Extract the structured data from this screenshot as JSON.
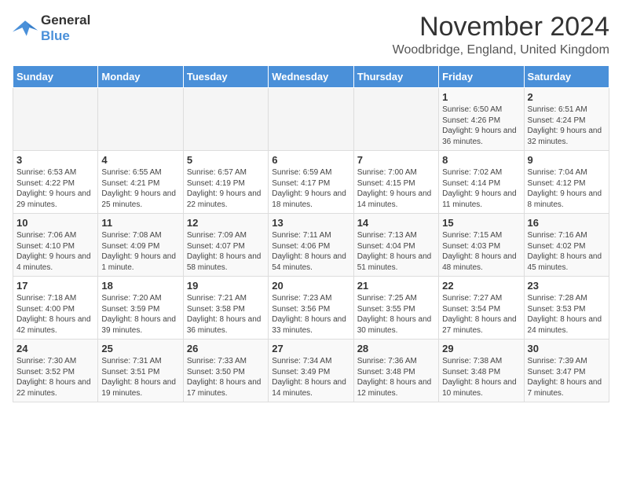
{
  "header": {
    "logo_line1": "General",
    "logo_line2": "Blue",
    "month": "November 2024",
    "location": "Woodbridge, England, United Kingdom"
  },
  "days_of_week": [
    "Sunday",
    "Monday",
    "Tuesday",
    "Wednesday",
    "Thursday",
    "Friday",
    "Saturday"
  ],
  "weeks": [
    [
      {
        "day": "",
        "info": ""
      },
      {
        "day": "",
        "info": ""
      },
      {
        "day": "",
        "info": ""
      },
      {
        "day": "",
        "info": ""
      },
      {
        "day": "",
        "info": ""
      },
      {
        "day": "1",
        "info": "Sunrise: 6:50 AM\nSunset: 4:26 PM\nDaylight: 9 hours and 36 minutes."
      },
      {
        "day": "2",
        "info": "Sunrise: 6:51 AM\nSunset: 4:24 PM\nDaylight: 9 hours and 32 minutes."
      }
    ],
    [
      {
        "day": "3",
        "info": "Sunrise: 6:53 AM\nSunset: 4:22 PM\nDaylight: 9 hours and 29 minutes."
      },
      {
        "day": "4",
        "info": "Sunrise: 6:55 AM\nSunset: 4:21 PM\nDaylight: 9 hours and 25 minutes."
      },
      {
        "day": "5",
        "info": "Sunrise: 6:57 AM\nSunset: 4:19 PM\nDaylight: 9 hours and 22 minutes."
      },
      {
        "day": "6",
        "info": "Sunrise: 6:59 AM\nSunset: 4:17 PM\nDaylight: 9 hours and 18 minutes."
      },
      {
        "day": "7",
        "info": "Sunrise: 7:00 AM\nSunset: 4:15 PM\nDaylight: 9 hours and 14 minutes."
      },
      {
        "day": "8",
        "info": "Sunrise: 7:02 AM\nSunset: 4:14 PM\nDaylight: 9 hours and 11 minutes."
      },
      {
        "day": "9",
        "info": "Sunrise: 7:04 AM\nSunset: 4:12 PM\nDaylight: 9 hours and 8 minutes."
      }
    ],
    [
      {
        "day": "10",
        "info": "Sunrise: 7:06 AM\nSunset: 4:10 PM\nDaylight: 9 hours and 4 minutes."
      },
      {
        "day": "11",
        "info": "Sunrise: 7:08 AM\nSunset: 4:09 PM\nDaylight: 9 hours and 1 minute."
      },
      {
        "day": "12",
        "info": "Sunrise: 7:09 AM\nSunset: 4:07 PM\nDaylight: 8 hours and 58 minutes."
      },
      {
        "day": "13",
        "info": "Sunrise: 7:11 AM\nSunset: 4:06 PM\nDaylight: 8 hours and 54 minutes."
      },
      {
        "day": "14",
        "info": "Sunrise: 7:13 AM\nSunset: 4:04 PM\nDaylight: 8 hours and 51 minutes."
      },
      {
        "day": "15",
        "info": "Sunrise: 7:15 AM\nSunset: 4:03 PM\nDaylight: 8 hours and 48 minutes."
      },
      {
        "day": "16",
        "info": "Sunrise: 7:16 AM\nSunset: 4:02 PM\nDaylight: 8 hours and 45 minutes."
      }
    ],
    [
      {
        "day": "17",
        "info": "Sunrise: 7:18 AM\nSunset: 4:00 PM\nDaylight: 8 hours and 42 minutes."
      },
      {
        "day": "18",
        "info": "Sunrise: 7:20 AM\nSunset: 3:59 PM\nDaylight: 8 hours and 39 minutes."
      },
      {
        "day": "19",
        "info": "Sunrise: 7:21 AM\nSunset: 3:58 PM\nDaylight: 8 hours and 36 minutes."
      },
      {
        "day": "20",
        "info": "Sunrise: 7:23 AM\nSunset: 3:56 PM\nDaylight: 8 hours and 33 minutes."
      },
      {
        "day": "21",
        "info": "Sunrise: 7:25 AM\nSunset: 3:55 PM\nDaylight: 8 hours and 30 minutes."
      },
      {
        "day": "22",
        "info": "Sunrise: 7:27 AM\nSunset: 3:54 PM\nDaylight: 8 hours and 27 minutes."
      },
      {
        "day": "23",
        "info": "Sunrise: 7:28 AM\nSunset: 3:53 PM\nDaylight: 8 hours and 24 minutes."
      }
    ],
    [
      {
        "day": "24",
        "info": "Sunrise: 7:30 AM\nSunset: 3:52 PM\nDaylight: 8 hours and 22 minutes."
      },
      {
        "day": "25",
        "info": "Sunrise: 7:31 AM\nSunset: 3:51 PM\nDaylight: 8 hours and 19 minutes."
      },
      {
        "day": "26",
        "info": "Sunrise: 7:33 AM\nSunset: 3:50 PM\nDaylight: 8 hours and 17 minutes."
      },
      {
        "day": "27",
        "info": "Sunrise: 7:34 AM\nSunset: 3:49 PM\nDaylight: 8 hours and 14 minutes."
      },
      {
        "day": "28",
        "info": "Sunrise: 7:36 AM\nSunset: 3:48 PM\nDaylight: 8 hours and 12 minutes."
      },
      {
        "day": "29",
        "info": "Sunrise: 7:38 AM\nSunset: 3:48 PM\nDaylight: 8 hours and 10 minutes."
      },
      {
        "day": "30",
        "info": "Sunrise: 7:39 AM\nSunset: 3:47 PM\nDaylight: 8 hours and 7 minutes."
      }
    ]
  ]
}
